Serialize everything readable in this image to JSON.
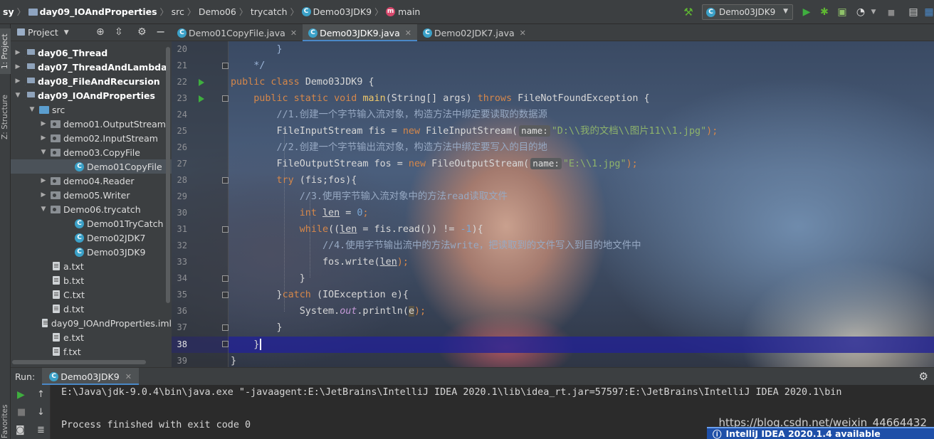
{
  "navbar": {
    "crumbs": [
      "sy",
      "day09_IOAndProperties",
      "src",
      "Demo06",
      "trycatch",
      "Demo03JDK9",
      "main"
    ],
    "run_config": "Demo03JDK9"
  },
  "stripe": {
    "project_tab": "1: Project",
    "structure_tab": "Z: Structure",
    "favorites_tab": "Favorites"
  },
  "project": {
    "title": "Project",
    "tree": [
      {
        "label": "day06_Thread",
        "kind": "module",
        "expanded": false,
        "bold": true
      },
      {
        "label": "day07_ThreadAndLambda",
        "kind": "module",
        "expanded": false,
        "bold": true
      },
      {
        "label": "day08_FileAndRecursion",
        "kind": "module",
        "expanded": false,
        "bold": true
      },
      {
        "label": "day09_IOAndProperties",
        "kind": "module",
        "expanded": true,
        "bold": true
      },
      {
        "label": "src",
        "kind": "source",
        "expanded": true
      },
      {
        "label": "demo01.OutputStream",
        "kind": "package",
        "expanded": false
      },
      {
        "label": "demo02.InputStream",
        "kind": "package",
        "expanded": false
      },
      {
        "label": "demo03.CopyFile",
        "kind": "package",
        "expanded": true
      },
      {
        "label": "Demo01CopyFile",
        "kind": "class",
        "selected": true
      },
      {
        "label": "demo04.Reader",
        "kind": "package",
        "expanded": false
      },
      {
        "label": "demo05.Writer",
        "kind": "package",
        "expanded": false
      },
      {
        "label": "Demo06.trycatch",
        "kind": "package",
        "expanded": true
      },
      {
        "label": "Demo01TryCatch",
        "kind": "class"
      },
      {
        "label": "Demo02JDK7",
        "kind": "class"
      },
      {
        "label": "Demo03JDK9",
        "kind": "class"
      },
      {
        "label": "a.txt",
        "kind": "file"
      },
      {
        "label": "b.txt",
        "kind": "file"
      },
      {
        "label": "C.txt",
        "kind": "file"
      },
      {
        "label": "d.txt",
        "kind": "file"
      },
      {
        "label": "day09_IOAndProperties.iml",
        "kind": "file"
      },
      {
        "label": "e.txt",
        "kind": "file"
      },
      {
        "label": "f.txt",
        "kind": "file"
      }
    ]
  },
  "tabs": [
    {
      "label": "Demo01CopyFile.java",
      "active": false
    },
    {
      "label": "Demo03JDK9.java",
      "active": true
    },
    {
      "label": "Demo02JDK7.java",
      "active": false
    }
  ],
  "editor": {
    "line_numbers": [
      "20",
      "21",
      "22",
      "23",
      "24",
      "25",
      "26",
      "27",
      "28",
      "29",
      "30",
      "31",
      "32",
      "33",
      "34",
      "35",
      "36",
      "37",
      "38",
      "39"
    ],
    "current_line": "38",
    "code": {
      "l20": "        }",
      "l21": "    */",
      "l22_kw": "public class ",
      "l22_rest": "Demo03JDK9 {",
      "l23_kw": "    public static void ",
      "l23_fn": "main",
      "l23_mid": "(String[] args) ",
      "l23_kw2": "throws ",
      "l23_rest": "FileNotFoundException {",
      "l24": "        //1.创建一个字节输入流对象，构造方法中绑定要读取的数据源",
      "l25_a": "        FileInputStream fis = ",
      "l25_kw": "new ",
      "l25_b": "FileInputStream(",
      "l25_hint": "name:",
      "l25_str": "\"D:\\\\我的文档\\\\图片11\\\\1.jpg\"",
      "l25_end": ");",
      "l26": "        //2.创建一个字节输出流对象，构造方法中绑定要写入的目的地",
      "l27_a": "        FileOutputStream fos = ",
      "l27_kw": "new ",
      "l27_b": "FileOutputStream(",
      "l27_hint": "name:",
      "l27_str": "\"E:\\\\1.jpg\"",
      "l27_end": ");",
      "l28_kw": "        try ",
      "l28_rest": "(fis;fos){",
      "l29": "            //3.使用字节输入流对象中的方法read读取文件",
      "l30_kw": "            int ",
      "l30_var": "len",
      "l30_mid": " = ",
      "l30_num": "0",
      "l30_end": ";",
      "l31_kw": "            while",
      "l31_a": "((",
      "l31_var": "len",
      "l31_b": " = fis.read()) != ",
      "l31_num": "-1",
      "l31_end": "){",
      "l32": "                //4.使用字节输出流中的方法write，把读取到的文件写入到目的地文件中",
      "l33_a": "                fos.write(",
      "l33_var": "len",
      "l33_end": ");",
      "l34": "            }",
      "l35_a": "        }",
      "l35_kw": "catch ",
      "l35_rest": "(IOException e){",
      "l36_a": "            System.",
      "l36_it": "out",
      "l36_b": ".println(",
      "l36_var": "e",
      "l36_end": ");",
      "l37": "        }",
      "l38": "    }",
      "l39": "}"
    }
  },
  "run": {
    "label": "Run:",
    "tab": "Demo03JDK9",
    "line1": "E:\\Java\\jdk-9.0.4\\bin\\java.exe \"-javaagent:E:\\JetBrains\\IntelliJ IDEA 2020.1\\lib\\idea_rt.jar=57597:E:\\JetBrains\\IntelliJ IDEA 2020.1\\bin",
    "line2": "Process finished with exit code 0"
  },
  "watermark": "https://blog.csdn.net/weixin_44664432",
  "notification": "IntelliJ IDEA 2020.1.4 available",
  "colors": {
    "accent": "#4a88c7",
    "run_green": "#3fae3f",
    "bug_green": "#5fb832",
    "stop_red": "#c75450"
  }
}
